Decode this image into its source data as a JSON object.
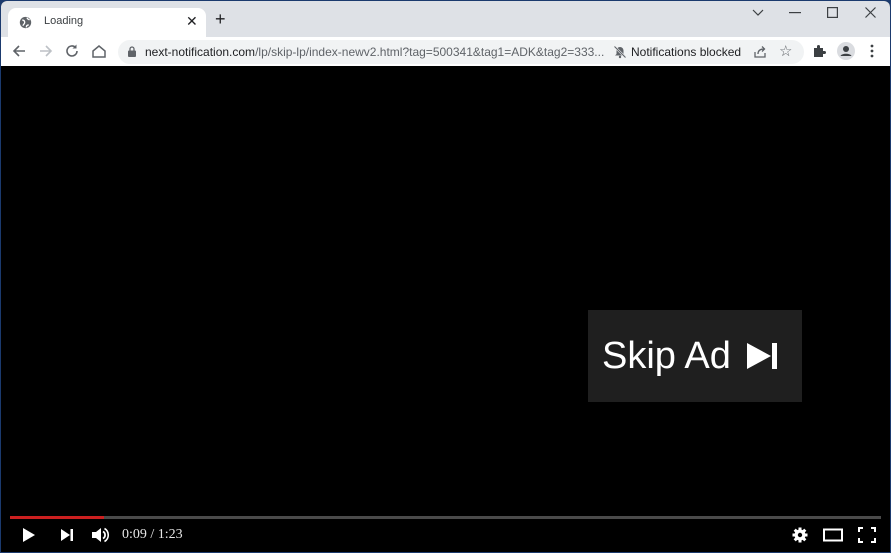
{
  "browser": {
    "tab": {
      "title": "Loading",
      "favicon": "globe-icon"
    },
    "new_tab_label": "+",
    "window_controls": [
      "tab-search-icon",
      "minimize-icon",
      "maximize-icon",
      "close-icon"
    ],
    "address": {
      "host": "next-notification.com",
      "path": "/lp/skip-lp/index-newv2.html?tag=500341&tag1=ADK&tag2=333...",
      "notifications_status": "Notifications blocked"
    }
  },
  "video": {
    "skip_ad_label": "Skip Ad",
    "current_time": "0:09",
    "duration": "1:23",
    "time_display": "0:09 / 1:23",
    "progress_fraction": 0.108,
    "progress_color": "#cc1f1f"
  }
}
